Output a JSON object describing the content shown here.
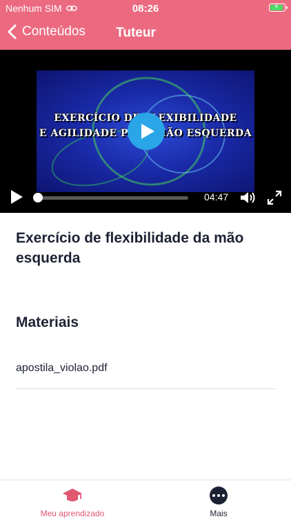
{
  "status_bar": {
    "carrier": "Nenhum SIM",
    "time": "08:26",
    "battery_color": "#4cd964"
  },
  "header": {
    "back_label": "Conteúdos",
    "title": "Tuteur",
    "background": "#ec6a80"
  },
  "video": {
    "caption_line1": "EXERCÍCIO DE FLEXIBILIDADE",
    "caption_line2": "E AGILIDADE PARA MÃO ESQUERDA",
    "duration": "04:47",
    "progress": 0,
    "play_button_color": "#2aa6e8"
  },
  "content": {
    "title": "Exercício de flexibilidade da mão esquerda",
    "materials_heading": "Materiais",
    "materials": [
      {
        "name": "apostila_violao.pdf"
      }
    ]
  },
  "tabbar": {
    "tabs": [
      {
        "label": "Meu aprendizado",
        "icon": "graduation-cap-icon",
        "active": true
      },
      {
        "label": "Mais",
        "icon": "more-dots-icon",
        "active": false
      }
    ],
    "active_color": "#e0566f"
  }
}
